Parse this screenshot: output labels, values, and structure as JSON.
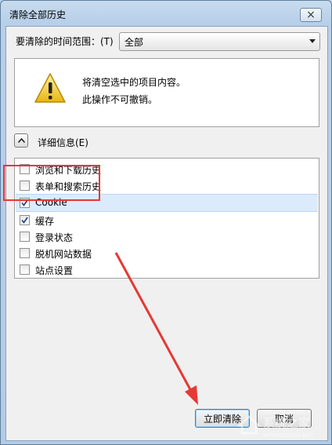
{
  "window": {
    "title": "清除全部历史",
    "close_symbol": "×"
  },
  "time_range": {
    "label": "要清除的时间范围：(T)",
    "value": "全部"
  },
  "warning": {
    "icon": "warning-icon",
    "line1": "将清空选中的项目内容。",
    "line2": "此操作不可撤销。"
  },
  "details": {
    "label": "详细信息(E)",
    "icon": "chevron-up-icon"
  },
  "items": [
    {
      "label": "浏览和下载历史",
      "checked": false
    },
    {
      "label": "表单和搜索历史",
      "checked": false
    },
    {
      "label": "Cookie",
      "checked": true
    },
    {
      "label": "缓存",
      "checked": true
    },
    {
      "label": "登录状态",
      "checked": false
    },
    {
      "label": "脱机网站数据",
      "checked": false
    },
    {
      "label": "站点设置",
      "checked": false
    }
  ],
  "buttons": {
    "clear": "立即清除",
    "cancel": "取消"
  },
  "colors": {
    "highlight": "#e53935",
    "arrow": "#e53935",
    "selection": "#dcebfc"
  },
  "watermark": {
    "text": "系统之家",
    "url": "XITONGZHIJIA.NET"
  }
}
